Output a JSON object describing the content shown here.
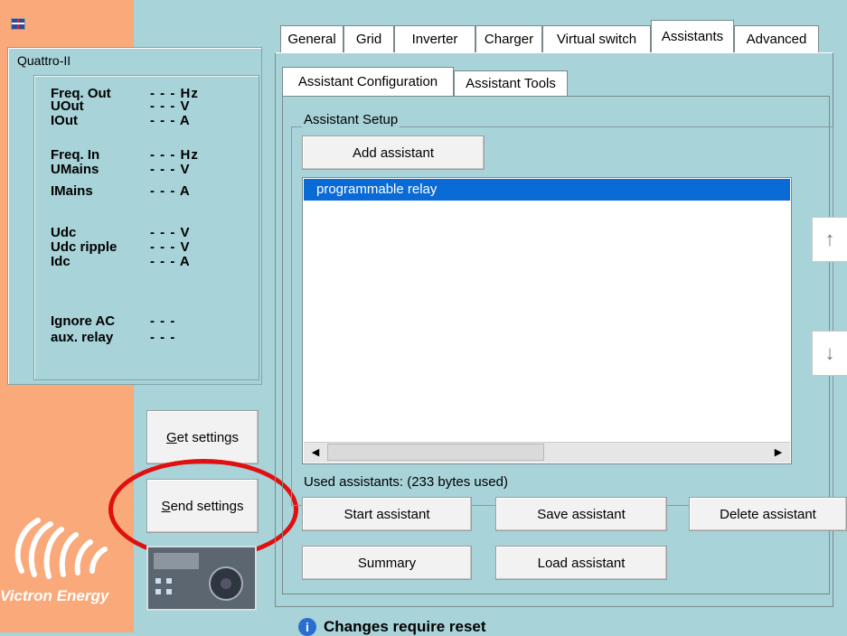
{
  "device": {
    "name": "Quattro-II",
    "status": [
      {
        "label": "Freq. Out",
        "value": "- - - Hz"
      },
      {
        "label": "UOut",
        "value": "- - - V"
      },
      {
        "label": "IOut",
        "value": "- - - A"
      },
      {
        "label": "Freq. In",
        "value": "- - - Hz"
      },
      {
        "label": "UMains",
        "value": "- - - V"
      },
      {
        "label": "IMains",
        "value": "- - - A"
      },
      {
        "label": "Udc",
        "value": "- - - V"
      },
      {
        "label": "Udc ripple",
        "value": "- - - V"
      },
      {
        "label": "Idc",
        "value": "- - - A"
      },
      {
        "label": "Ignore AC",
        "value": "- - -"
      },
      {
        "label": "aux. relay",
        "value": "- - -"
      }
    ]
  },
  "side_buttons": {
    "get_settings_underline": "G",
    "get_settings_rest": "et settings",
    "send_settings_underline": "S",
    "send_settings_rest": "end settings"
  },
  "brand": {
    "name": "Victron Energy"
  },
  "tabs": [
    "General",
    "Grid",
    "Inverter",
    "Charger",
    "Virtual switch",
    "Assistants",
    "Advanced"
  ],
  "active_tab": "Assistants",
  "subtabs": [
    "Assistant Configuration",
    "Assistant Tools"
  ],
  "active_subtab": "Assistant Configuration",
  "setup": {
    "legend": "Assistant Setup",
    "add_button": "Add assistant",
    "list_items": [
      "programmable relay"
    ],
    "used_label": "Used assistants: (233 bytes used)"
  },
  "actions": {
    "start": "Start assistant",
    "save": "Save assistant",
    "delete": "Delete assistant",
    "summary": "Summary",
    "load": "Load assistant"
  },
  "icons": {
    "up": "↑",
    "down": "↓",
    "left": "◀",
    "right": "▶",
    "info": "i"
  },
  "footer": {
    "note": "Changes require reset"
  },
  "colors": {
    "background": "#a8d3d8",
    "brand_orange": "#f9a97a",
    "selection": "#0a6ad6",
    "annotation_red": "#e01010"
  }
}
